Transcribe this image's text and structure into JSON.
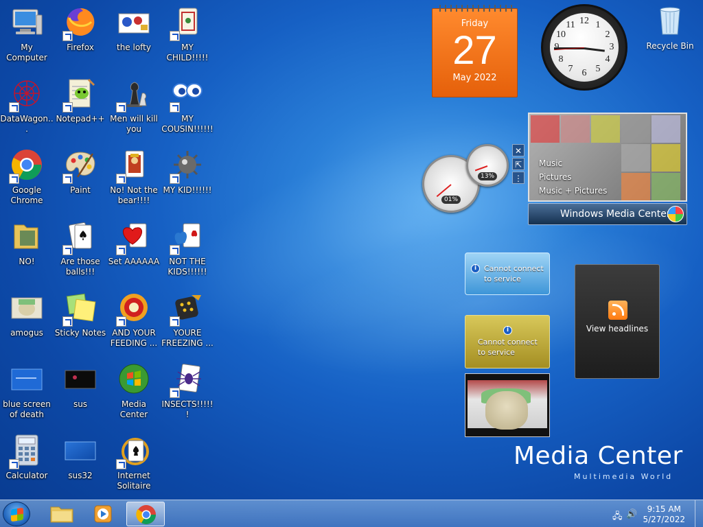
{
  "desktop_icons": [
    {
      "id": "my-computer",
      "label": "My Computer"
    },
    {
      "id": "firefox",
      "label": "Firefox"
    },
    {
      "id": "the-lofty",
      "label": "the lofty"
    },
    {
      "id": "my-child",
      "label": "MY CHILD!!!!!"
    },
    {
      "id": "datawagon",
      "label": "DataWagon..."
    },
    {
      "id": "notepad-plus-plus",
      "label": "Notepad++"
    },
    {
      "id": "men-will-kill-you",
      "label": "Men will kill you"
    },
    {
      "id": "my-cousin",
      "label": "MY COUSIN!!!!!!"
    },
    {
      "id": "google-chrome",
      "label": "Google Chrome"
    },
    {
      "id": "paint",
      "label": "Paint"
    },
    {
      "id": "no-not-the-bear",
      "label": "No! Not the bear!!!!"
    },
    {
      "id": "my-kid",
      "label": "MY KID!!!!!!"
    },
    {
      "id": "no",
      "label": "NO!"
    },
    {
      "id": "are-those-balls",
      "label": "Are those balls!!!"
    },
    {
      "id": "set-aaaaaa",
      "label": "Set AAAAAA"
    },
    {
      "id": "not-the-kids",
      "label": "NOT THE KIDS!!!!!!"
    },
    {
      "id": "amogus",
      "label": "amogus"
    },
    {
      "id": "sticky-notes",
      "label": "Sticky Notes"
    },
    {
      "id": "and-your-feeding",
      "label": "AND YOUR FEEDING ..."
    },
    {
      "id": "youre-freezing",
      "label": "YOURE FREEZING ..."
    },
    {
      "id": "blue-screen-of-death",
      "label": "blue screen of death"
    },
    {
      "id": "sus",
      "label": "sus"
    },
    {
      "id": "media-center",
      "label": "Media Center"
    },
    {
      "id": "insects",
      "label": "INSECTS!!!!!!"
    },
    {
      "id": "calculator",
      "label": "Calculator"
    },
    {
      "id": "sus32",
      "label": "sus32"
    },
    {
      "id": "internet-solitaire",
      "label": "Internet Solitaire"
    },
    {
      "id": "recycle-bin",
      "label": "Recycle Bin"
    }
  ],
  "calendar": {
    "weekday": "Friday",
    "day": "27",
    "month_year": "May 2022"
  },
  "clock": {
    "numbers": [
      "12",
      "1",
      "2",
      "3",
      "4",
      "5",
      "6",
      "7",
      "8",
      "9",
      "10",
      "11"
    ]
  },
  "cpu_meter": {
    "cpu_percent": "01%",
    "memory_percent": "13%"
  },
  "media_center_gadget": {
    "menu": [
      "Music",
      "Pictures",
      "Music + Pictures"
    ],
    "title": "Windows Media Center"
  },
  "service_1": {
    "message": "Cannot connect to service"
  },
  "service_2": {
    "message": "Cannot connect to service"
  },
  "feed": {
    "label": "View headlines"
  },
  "brand": {
    "title": "Media Center",
    "subtitle": "Multimedia World"
  },
  "taskbar": {
    "time": "9:15 AM",
    "date": "5/27/2022"
  },
  "colors": {
    "calendar": "#e5600a",
    "taskbar": "#6b9ad6",
    "desktop": "#1660c4"
  }
}
